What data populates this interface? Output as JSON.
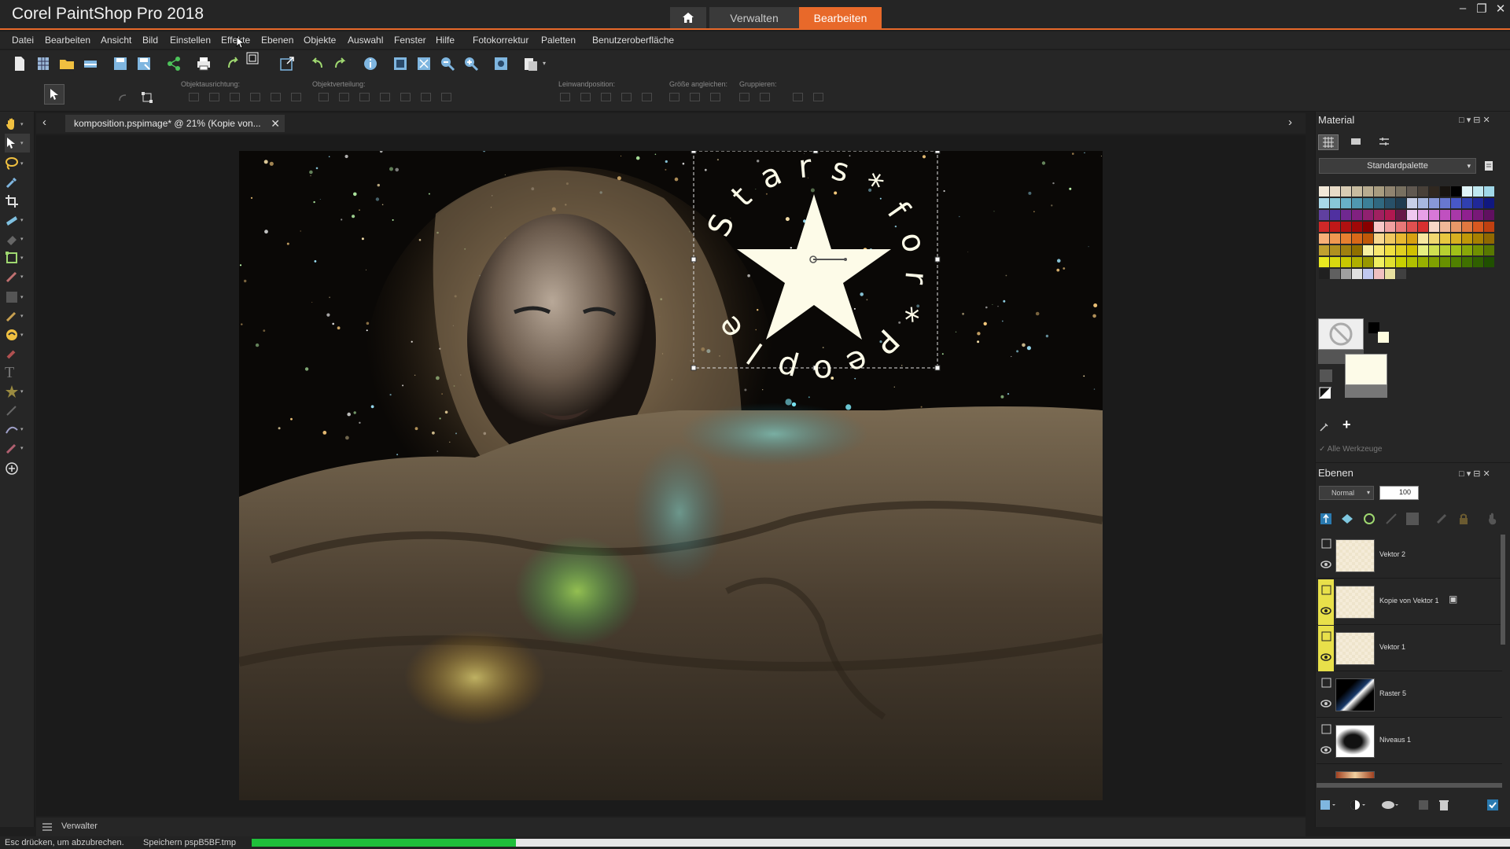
{
  "app": {
    "title": "Corel PaintShop Pro 2018",
    "mode_tabs": [
      "Verwalten",
      "Bearbeiten"
    ],
    "active_mode": "Bearbeiten"
  },
  "menu": [
    "Datei",
    "Bearbeiten",
    "Ansicht",
    "Bild",
    "Einstellen",
    "Effekte",
    "Ebenen",
    "Objekte",
    "Auswahl",
    "Fenster",
    "Hilfe",
    "Fotokorrektur",
    "Paletten",
    "Benutzeroberfläche"
  ],
  "options_bar": {
    "labels": [
      "Objektausrichtung:",
      "Objektverteilung:",
      "Leinwandposition:",
      "Größe angleichen:",
      "Gruppieren:"
    ]
  },
  "document": {
    "tab_title": "komposition.pspimage* @  21% (Kopie von...",
    "text_chars": [
      "S",
      "t",
      "a",
      "r",
      "s",
      "*",
      "f",
      "o",
      "r",
      "*",
      "P",
      "e",
      "o",
      "p",
      "l",
      "e"
    ]
  },
  "material_panel": {
    "title": "Material",
    "palette": "Standardpalette",
    "all_tools_label": "Alle Werkzeuge"
  },
  "layers_panel": {
    "title": "Ebenen",
    "blend_mode": "Normal",
    "opacity": "100",
    "layers": [
      {
        "name": "Vektor 2",
        "highlight": false
      },
      {
        "name": "Kopie von Vektor 1",
        "highlight": true
      },
      {
        "name": "Vektor 1",
        "highlight": true
      },
      {
        "name": "Raster 5",
        "highlight": false
      },
      {
        "name": "Niveaus 1",
        "highlight": false
      }
    ]
  },
  "bottom": {
    "verwalter_label": "Verwalter",
    "status_hint": "Esc drücken, um abzubrechen.",
    "status_task": "Speichern pspB5BF.tmp",
    "progress": 0.21
  },
  "colors": {
    "accent": "#e8692a",
    "progress": "#1fbf3a",
    "layer_highlight": "#e8e04a"
  }
}
